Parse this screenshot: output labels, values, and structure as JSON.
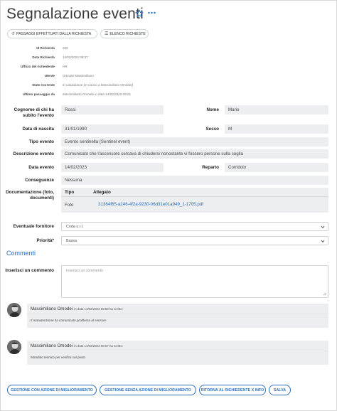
{
  "page": {
    "title": "Segnalazione eventi"
  },
  "toolbar": {
    "passaggi_label": "PASSAGGI EFFETTUATI DALLA RICHIESTA",
    "elenco_label": "ELENCO RICHIESTE"
  },
  "meta": [
    {
      "label": "Id Richiesta",
      "value": "339"
    },
    {
      "label": "Data Richiesta",
      "value": "14/02/2023 08:37"
    },
    {
      "label": "Ufficio del richiedente",
      "value": "HR"
    },
    {
      "label": "Utente",
      "value": "Omodei Massimiliano"
    },
    {
      "label": "Stato Corrente",
      "value": "In valutazione (In carico a Massimiliano Omodei)"
    },
    {
      "label": "Ultimo passaggio da",
      "value": "Massimiliano Omodei in data 14/02/2023 09:01"
    }
  ],
  "form": {
    "cognome": {
      "label": "Cognome di chi ha subito l'evento",
      "value": "Rossi"
    },
    "nome": {
      "label": "Nome",
      "value": "Mario"
    },
    "data_nascita": {
      "label": "Data di nascita",
      "value": "31/01/1990"
    },
    "sesso": {
      "label": "Sesso",
      "value": "M"
    },
    "tipo_evento": {
      "label": "Tipo evento",
      "value": "Evento sentinella (Sentinel event)"
    },
    "descrizione": {
      "label": "Descrizione evento",
      "value": "Comunicato che l'ascensore cercava di chiudersi nonostante vi fossero persone sulla soglia"
    },
    "data_evento": {
      "label": "Data evento",
      "value": "14/02/2023"
    },
    "reparto": {
      "label": "Reparto",
      "value": "Corridoio"
    },
    "conseguenze": {
      "label": "Conseguenze",
      "value": "Nessuna"
    },
    "documentazione": {
      "label": "Documentazione (foto, documenti)",
      "col_tipo": "Tipo",
      "col_allegato": "Allegato",
      "row_tipo": "Foto",
      "row_allegato": "31364f65-a246-4f2a-9230-06d31e01a949_1-1705.pdf"
    },
    "fornitore": {
      "label": "Eventuale fornitore",
      "value": "Coda s.r.l."
    },
    "priorita": {
      "label": "Priorità",
      "required_mark": "*",
      "value": "Bassa"
    }
  },
  "comments": {
    "section_title": "Commenti",
    "input_label": "Inserisci un commento",
    "placeholder": "Inserisci un commento",
    "items": [
      {
        "author": "Massimiliano Omodei",
        "date": "in data 14/02/2023 08:59 ha scritto:",
        "text": "Il manutenzione ha comunicato problema al sensore"
      },
      {
        "author": "Massimiliano Omodei",
        "date": "in data 14/02/2023 08:57 ha scritto:",
        "text": "Mandato tecnico per verifica sul posto"
      }
    ]
  },
  "actions": {
    "gestione_azione": "GESTIONE CON AZIONE DI MIGLIORAMENTO",
    "gestione_senza": "GESTIONE SENZA AZIONE DI MIGLIORAMENTO",
    "ritorna": "RITORNA AL RICHIEDENTE X INFO",
    "salva": "SALVA"
  },
  "colors": {
    "accent": "#2a6ebb",
    "field_bg": "#eceeef"
  }
}
